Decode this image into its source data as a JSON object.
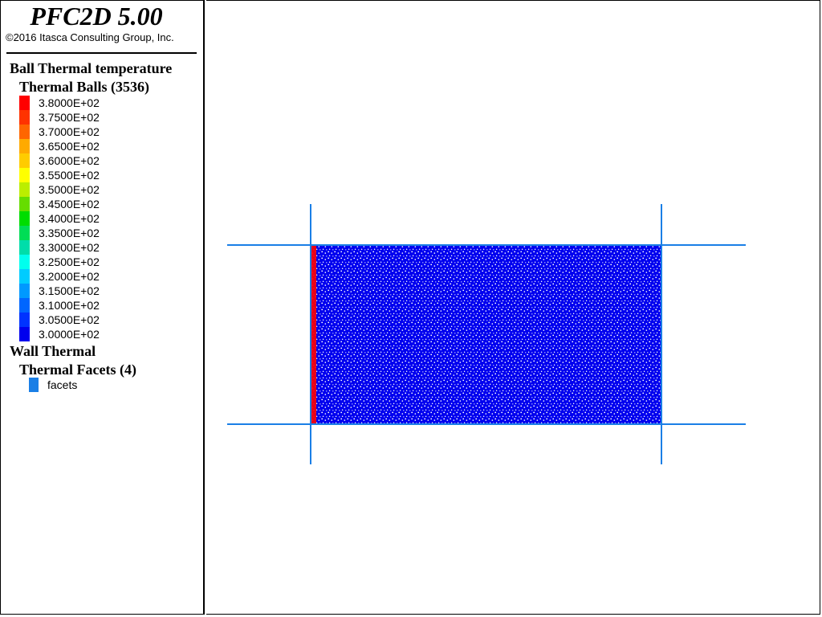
{
  "header": {
    "app_title": "PFC2D 5.00",
    "copyright": "©2016 Itasca Consulting Group, Inc."
  },
  "legend": {
    "ball_section_title": "Ball Thermal temperature",
    "ball_group_title": "Thermal Balls (3536)",
    "scale": [
      {
        "label": "3.8000E+02",
        "color": "#ff0000"
      },
      {
        "label": "3.7500E+02",
        "color": "#ff3300"
      },
      {
        "label": "3.7000E+02",
        "color": "#ff6600"
      },
      {
        "label": "3.6500E+02",
        "color": "#ffaa00"
      },
      {
        "label": "3.6000E+02",
        "color": "#ffcc00"
      },
      {
        "label": "3.5500E+02",
        "color": "#ffff00"
      },
      {
        "label": "3.5000E+02",
        "color": "#bbee00"
      },
      {
        "label": "3.4500E+02",
        "color": "#66dd00"
      },
      {
        "label": "3.4000E+02",
        "color": "#00dd00"
      },
      {
        "label": "3.3500E+02",
        "color": "#00dd55"
      },
      {
        "label": "3.3000E+02",
        "color": "#00ddaa"
      },
      {
        "label": "3.2500E+02",
        "color": "#00ffee"
      },
      {
        "label": "3.2000E+02",
        "color": "#00ccff"
      },
      {
        "label": "3.1500E+02",
        "color": "#0099ff"
      },
      {
        "label": "3.1000E+02",
        "color": "#0066ff"
      },
      {
        "label": "3.0500E+02",
        "color": "#0033ff"
      },
      {
        "label": "3.0000E+02",
        "color": "#0000ee"
      }
    ],
    "wall_section_title": "Wall Thermal",
    "wall_group_title": "Thermal Facets (4)",
    "facets_label": "facets",
    "facets_color": "#1a7fe6"
  },
  "plot": {
    "ball_color": "#0000ee",
    "hot_edge_color": "#ff0000",
    "wall_color": "#1a7fe6"
  }
}
